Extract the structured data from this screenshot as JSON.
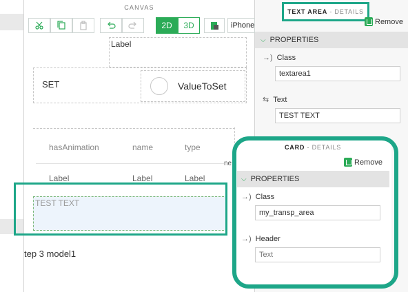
{
  "canvas": {
    "title": "CANVAS",
    "toolbar": {
      "mode_2d": "2D",
      "mode_3d": "3D",
      "device": "iPhone"
    },
    "widgets": {
      "top_label": "Label",
      "set_text": "SET",
      "value_text": "ValueToSet",
      "table_headers": [
        "hasAnimation",
        "name",
        "type"
      ],
      "table_cells": [
        "Label",
        "Label",
        "Label"
      ],
      "text_area_value": "TEST TEXT",
      "step_text": "tep 3 model1",
      "edge_text": "ne"
    }
  },
  "text_area_details": {
    "title": "TEXT AREA",
    "subtitle": "- DETAILS",
    "remove_label": "Remove",
    "section_label": "PROPERTIES",
    "fields": [
      {
        "label": "Class",
        "value": "textarea1"
      },
      {
        "label": "Text",
        "value": "TEST TEXT"
      }
    ]
  },
  "card_details": {
    "title": "CARD",
    "subtitle": "- DETAILS",
    "remove_label": "Remove",
    "section_label": "PROPERTIES",
    "fields": [
      {
        "label": "Class",
        "value": "my_transp_area",
        "placeholder": ""
      },
      {
        "label": "Header",
        "value": "",
        "placeholder": "Text"
      }
    ]
  },
  "colors": {
    "accent_green": "#2bab57",
    "highlight_teal": "#1da688"
  }
}
